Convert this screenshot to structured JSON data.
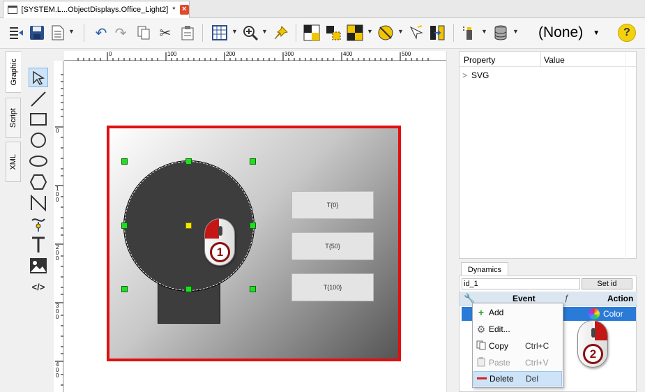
{
  "document_tab": {
    "title": "[SYSTEM.L...ObjectDisplays.Office_Light2]",
    "modified_marker": "*"
  },
  "toolbar": {
    "object_selector": "(None)",
    "help_label": "?"
  },
  "side_tabs": [
    "Graphic",
    "Script",
    "XML"
  ],
  "tools": [
    "select-arrow",
    "line",
    "rectangle",
    "circle",
    "ellipse",
    "hexagon",
    "polyline",
    "path-tool",
    "text",
    "image",
    "code"
  ],
  "ruler": {
    "h_labels": [
      "0",
      "100",
      "200",
      "300",
      "400",
      "500"
    ],
    "v_labels": [
      "0",
      "100",
      "200",
      "300",
      "400"
    ]
  },
  "canvas": {
    "text_buttons": [
      "T{0}",
      "T{50}",
      "T{100}"
    ],
    "callout_1": "1",
    "callout_2": "2"
  },
  "properties": {
    "col_property": "Property",
    "col_value": "Value",
    "rows": [
      {
        "label": "SVG",
        "expand_icon": ">"
      }
    ]
  },
  "dynamics": {
    "tab_label": "Dynamics",
    "id_value": "id_1",
    "set_id_label": "Set id",
    "col_event": "Event",
    "col_function_icon": "ƒ",
    "col_action": "Action",
    "selected_action": "Color"
  },
  "context_menu": {
    "items": [
      {
        "label": "Add",
        "shortcut": "",
        "icon": "plus-icon",
        "enabled": true
      },
      {
        "label": "Edit...",
        "shortcut": "",
        "icon": "gears-icon",
        "enabled": true
      },
      {
        "label": "Copy",
        "shortcut": "Ctrl+C",
        "icon": "copy-icon",
        "enabled": true
      },
      {
        "label": "Paste",
        "shortcut": "Ctrl+V",
        "icon": "paste-icon",
        "enabled": false
      },
      {
        "label": "Delete",
        "shortcut": "Del",
        "icon": "minus-icon",
        "enabled": true
      }
    ]
  },
  "colors": {
    "selection_border": "#e01010",
    "handle": "#22dd22",
    "row_selected": "#2a7bd8",
    "menu_hover": "#cde3f7"
  }
}
